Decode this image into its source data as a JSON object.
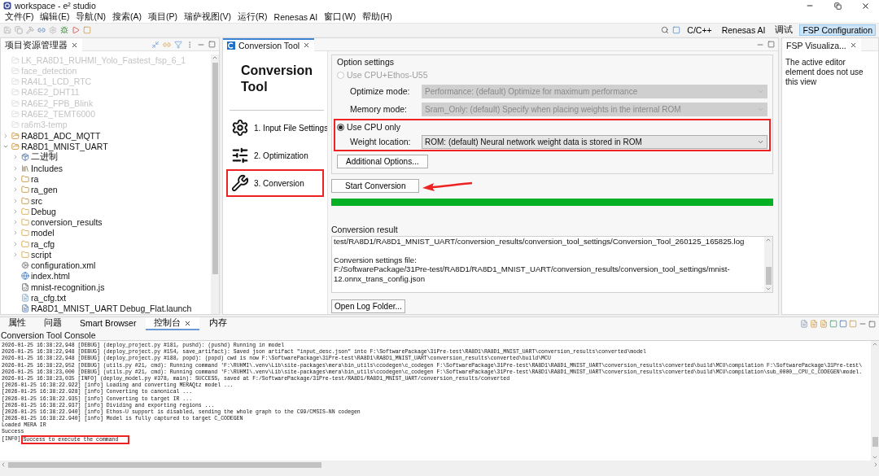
{
  "window": {
    "title": "workspace - e² studio"
  },
  "menu": [
    "文件(F)",
    "编辑(E)",
    "导航(N)",
    "搜索(A)",
    "项目(P)",
    "瑞萨视图(V)",
    "运行(R)",
    "Renesas AI",
    "窗口(W)",
    "帮助(H)"
  ],
  "perspectives": [
    {
      "label": "C/C++",
      "selected": false
    },
    {
      "label": "Renesas AI",
      "selected": false
    },
    {
      "label": "调试",
      "selected": false
    },
    {
      "label": "FSP Configuration",
      "selected": true
    }
  ],
  "explorer": {
    "tab": "项目资源管理器",
    "tree": [
      {
        "label": "LK_RA8D1_RUHMI_Yolo_Fastest_fsp_6_1",
        "kind": "project",
        "dimmed": true
      },
      {
        "label": "face_detection",
        "kind": "project",
        "dimmed": true
      },
      {
        "label": "RA4L1_LCD_RTC",
        "kind": "project",
        "dimmed": true
      },
      {
        "label": "RA6E2_DHT11",
        "kind": "project",
        "dimmed": true
      },
      {
        "label": "RA6E2_FPB_Blink",
        "kind": "project",
        "dimmed": true
      },
      {
        "label": "RA6E2_TEMT6000",
        "kind": "project",
        "dimmed": true
      },
      {
        "label": "ra6m3-temp",
        "kind": "project",
        "dimmed": true
      },
      {
        "label": "RA8D1_ADC_MQTT",
        "kind": "project",
        "dimmed": false,
        "expanded": false
      },
      {
        "label": "RA8D1_MNIST_UART",
        "kind": "project",
        "dimmed": false,
        "expanded": true,
        "children": [
          {
            "label": "二进制",
            "kind": "binaries",
            "expanded": false
          },
          {
            "label": "Includes",
            "kind": "includes",
            "expanded": false
          },
          {
            "label": "ra",
            "kind": "source",
            "expanded": false
          },
          {
            "label": "ra_gen",
            "kind": "source",
            "expanded": false
          },
          {
            "label": "src",
            "kind": "source",
            "expanded": false
          },
          {
            "label": "Debug",
            "kind": "folder",
            "expanded": false
          },
          {
            "label": "conversion_results",
            "kind": "folder",
            "expanded": false
          },
          {
            "label": "model",
            "kind": "folder",
            "expanded": false
          },
          {
            "label": "ra_cfg",
            "kind": "folder",
            "expanded": false
          },
          {
            "label": "script",
            "kind": "folder",
            "expanded": false
          },
          {
            "label": "configuration.xml",
            "kind": "config"
          },
          {
            "label": "index.html",
            "kind": "web"
          },
          {
            "label": "mnist-recognition.js",
            "kind": "script"
          },
          {
            "label": "ra_cfg.txt",
            "kind": "text"
          },
          {
            "label": "RA8D1_MNIST_UART Debug_Flat.launch",
            "kind": "launch"
          }
        ]
      }
    ]
  },
  "editor": {
    "tab": "Conversion Tool",
    "title": "Conversion Tool",
    "steps": [
      {
        "label": "1. Input File Settings",
        "kind": "gear",
        "annotated": false
      },
      {
        "label": "2. Optimization",
        "kind": "sliders",
        "annotated": false
      },
      {
        "label": "3. Conversion",
        "kind": "wrench",
        "annotated": true
      }
    ],
    "options": {
      "title": "Option settings",
      "ethos": {
        "label": "Use CPU+Ethos-U55",
        "selected": false,
        "disabled": true,
        "fields": [
          {
            "label": "Optimize mode:",
            "value": "Performance: (default) Optimize for maximum performance"
          },
          {
            "label": "Memory mode:",
            "value": "Sram_Only: (default) Specify when placing weights in the internal ROM"
          }
        ]
      },
      "cpu": {
        "label": "Use CPU only",
        "selected": true,
        "disabled": false,
        "annotated": true,
        "fields": [
          {
            "label": "Weight location:",
            "value": "ROM: (default) Neural network weight data is stored in ROM"
          }
        ]
      },
      "additional_button": "Additional Options..."
    },
    "start_button": {
      "label": "Start Conversion",
      "annotated": true
    },
    "progress": {
      "level": 1
    },
    "result": {
      "label": "Conversion result",
      "paragraphs": [
        [
          "test/RA8D1/RA8D1_MNIST_UART/conversion_results/conversion_tool_settings/Conversion_Tool_260125_165825.log"
        ],
        [
          "Conversion settings file:",
          "F:/SoftwarePackage/31Pre-test/RA8D1/RA8D1_MNIST_UART/conversion_results/conversion_tool_settings/mnist-",
          "12.onnx_trans_config.json"
        ]
      ]
    },
    "log_button": "Open Log Folder..."
  },
  "side_view": {
    "tab": "FSP Visualiza...",
    "message": "The active editor element does not use this view"
  },
  "console": {
    "tabs": [
      {
        "label": "属性",
        "selected": false
      },
      {
        "label": "问题",
        "selected": false
      },
      {
        "label": "Smart Browser",
        "selected": false
      },
      {
        "label": "控制台",
        "selected": true
      },
      {
        "label": "内存",
        "selected": false
      }
    ],
    "title": "Conversion Tool Console",
    "lines": [
      {
        "text": "2026-01-25 16:38:22,948 [DEBUG] (deploy_project.py #181, pushd): (pushd) Running in model",
        "annotated": false
      },
      {
        "text": "2026-01-25 16:38:22,948 [DEBUG] (deploy_project.py #154, save_artifact): Saved json artifact \"input_desc.json\" into F:\\SoftwarePackage\\31Pre-test\\RA8D1\\RA8D1_MNIST_UART\\conversion_results\\converted\\model",
        "annotated": false
      },
      {
        "text": "2026-01-25 16:38:22,948 [DEBUG] (deploy_project.py #188, popd): (popd) cwd is now F:\\SoftwarePackage\\31Pre-test\\RA8D1\\RA8D1_MNIST_UART\\conversion_results\\converted\\build\\MCU",
        "annotated": false
      },
      {
        "text": "2026-01-25 16:38:22,952 [DEBUG] (utils.py #21, cmd): Running command 'F:\\RUHMI\\.venv\\Lib\\site-packages\\mera\\bin_utils\\ccodegen\\c_codegen F:\\SoftwarePackage\\31Pre-test\\RA8D1\\RA8D1_MNIST_UART\\conversion_results\\converted\\build\\MCU\\compilation F:\\SoftwarePackage\\31Pre-test\\",
        "annotated": false
      },
      {
        "text": "2026-01-25 16:38:23,000 [DEBUG] (utils.py #21, cmd): Running command 'F:\\RUHMI\\.venv\\Lib\\site-packages\\mera\\bin_utils\\ccodegen\\c_codegen F:\\SoftwarePackage\\31Pre-test\\RA8D1\\RA8D1_MNIST_UART\\conversion_results\\converted\\build\\MCU\\compilation\\sub_0000__CPU_C_CODEGEN\\model.",
        "annotated": false
      },
      {
        "text": "2026-01-25 16:38:23,035 [INFO] (deploy_model.py #378, main): SUCCESS, saved at F:/SoftwarePackage/31Pre-test/RA8D1/RA8D1_MNIST_UART/conversion_results/converted",
        "annotated": false
      },
      {
        "text": "[2026-01-25 16:38:22.922] [info] Loading and converting MERAQtz model ...",
        "annotated": false
      },
      {
        "text": "[2026-01-25 16:38:22.928] [info] Converting to canonical ...",
        "annotated": false
      },
      {
        "text": "[2026-01-25 16:38:22.935] [info] Converting to target IR ...",
        "annotated": false
      },
      {
        "text": "[2026-01-25 16:38:22.937] [info] Dividing and exporting regions ...",
        "annotated": false
      },
      {
        "text": "[2026-01-25 16:38:22.940] [info] Ethos-U support is disabled, sending the whole graph to the C99/CMSIS-NN codegen",
        "annotated": false
      },
      {
        "text": "[2026-01-25 16:38:22.940] [info] Model is fully captured to target C_CODEGEN",
        "annotated": false
      },
      {
        "text": "Loaded MERA IR",
        "annotated": false
      },
      {
        "text": "Success",
        "annotated": false
      },
      {
        "prefix": "[INFO]",
        "text": "Success to execute the command",
        "annotated": true
      }
    ]
  }
}
